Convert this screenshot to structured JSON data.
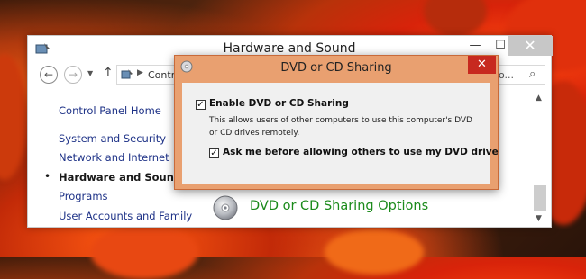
{
  "window": {
    "title": "Hardware and Sound",
    "controls": {
      "minimize": "—",
      "maximize": "☐",
      "close": "✕"
    }
  },
  "navbar": {
    "back_icon": "back-arrow-icon",
    "forward_icon": "forward-arrow-icon",
    "address_text": "Contro",
    "search_placeholder": "o..."
  },
  "sidebar": {
    "items": [
      {
        "label": "Control Panel Home",
        "active": false
      },
      {
        "label": "System and Security",
        "active": false
      },
      {
        "label": "Network and Internet",
        "active": false
      },
      {
        "label": "Hardware and Sound",
        "active": true
      },
      {
        "label": "Programs",
        "active": false
      },
      {
        "label": "User Accounts and Family",
        "active": false
      }
    ],
    "bullet": "•"
  },
  "main": {
    "option_label": "DVD or CD Sharing Options",
    "option_label_color": "#1a8a1a"
  },
  "dialog": {
    "title": "DVD or CD Sharing",
    "close": "✕",
    "enable_label": "Enable DVD or CD Sharing",
    "enable_checked": true,
    "enable_description": "This allows users of other computers to use this computer's DVD or CD drives remotely.",
    "ask_label": "Ask me before allowing others to use my DVD drive",
    "ask_checked": true,
    "accent_color": "#e9a070",
    "close_color": "#c7291f"
  },
  "colors": {
    "link": "#1e3287",
    "wallpaper_primary": "#d8230a"
  }
}
